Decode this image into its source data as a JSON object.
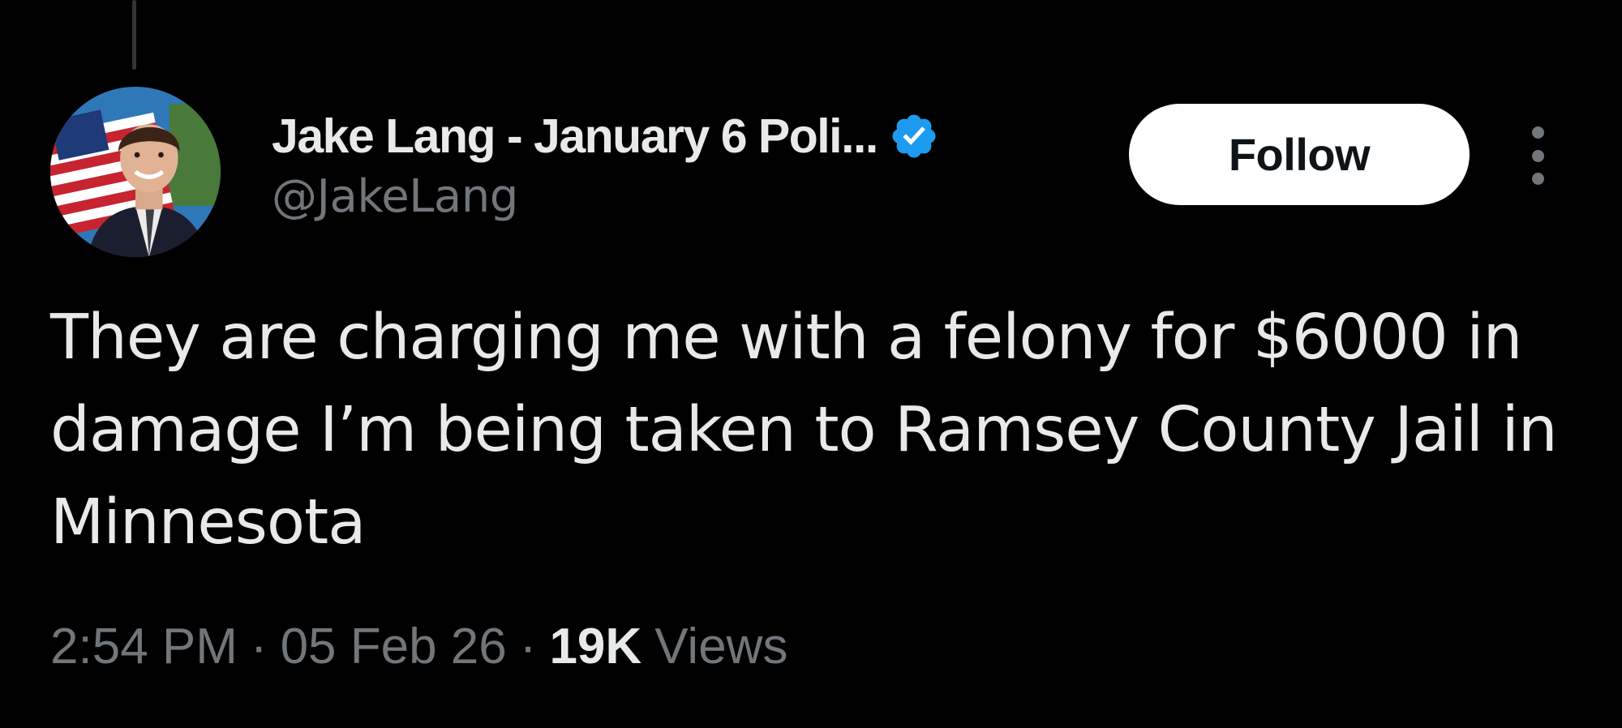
{
  "author": {
    "display_name": "Jake Lang - January 6 Poli...",
    "handle": "@JakeLang",
    "verified": true,
    "verified_color": "#1d9bf0",
    "avatar_icon": "profile-photo-with-american-flag"
  },
  "actions": {
    "follow_label": "Follow",
    "more_icon": "vertical-ellipsis-icon"
  },
  "tweet": {
    "text": "They are charging me with a felony for $6000 in damage I’m being taken to Ramsey County Jail in Minnesota"
  },
  "meta": {
    "time": "2:54 PM",
    "separator": "·",
    "date": "05 Feb 26",
    "views_count": "19K",
    "views_label": "Views"
  },
  "colors": {
    "background": "#000000",
    "primary_text": "#e7e9ea",
    "secondary_text": "#71767b",
    "follow_button_bg": "#ffffff",
    "follow_button_text": "#0f1419"
  }
}
